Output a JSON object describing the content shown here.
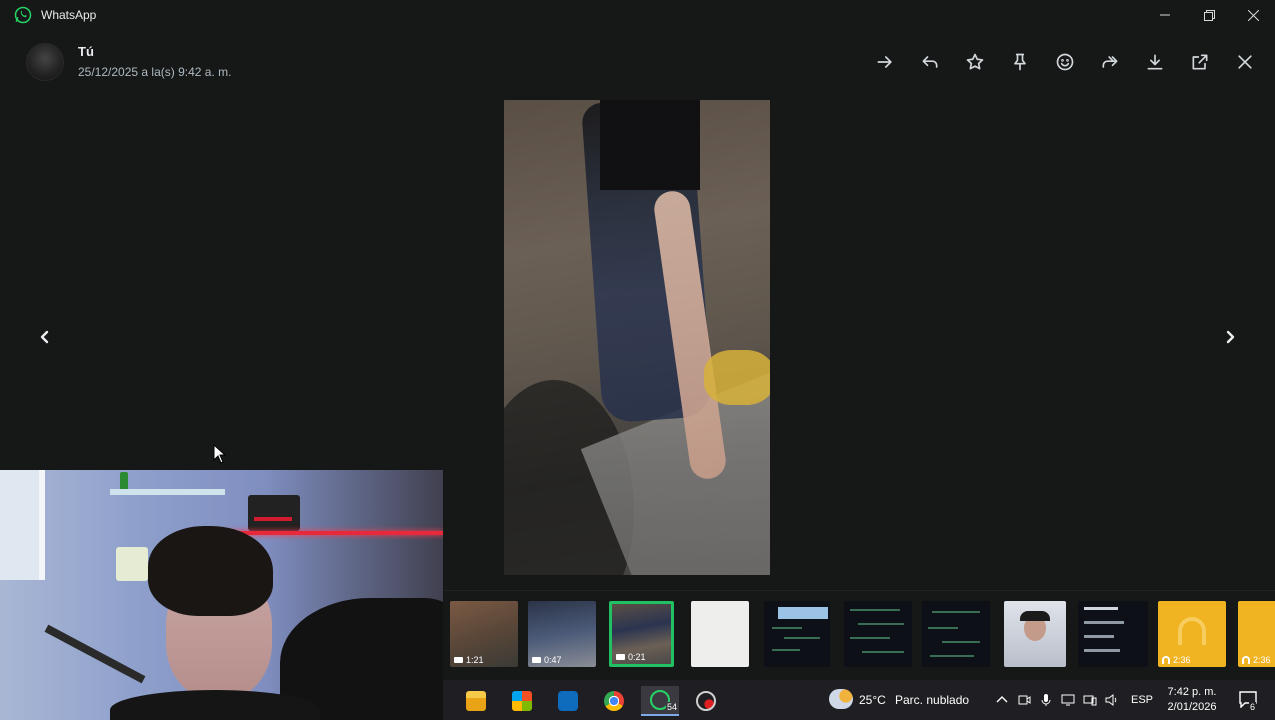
{
  "window": {
    "app_title": "WhatsApp",
    "icons": [
      "whatsapp-logo-icon",
      "minimize-icon",
      "restore-icon",
      "close-icon"
    ]
  },
  "viewer": {
    "sender_name": "Tú",
    "timestamp": "25/12/2025 a la(s) 9:42 a. m.",
    "actions": [
      "go-to-message-icon",
      "reply-icon",
      "star-icon",
      "pin-icon",
      "react-emoji-icon",
      "forward-icon",
      "download-icon",
      "open-external-icon",
      "close-viewer-icon"
    ]
  },
  "thumbnails": [
    {
      "kind": "video",
      "duration": "1:21",
      "selected": false
    },
    {
      "kind": "video",
      "duration": "0:47",
      "selected": false
    },
    {
      "kind": "video",
      "duration": "0:21",
      "selected": true
    },
    {
      "kind": "image",
      "duration": "",
      "selected": false
    },
    {
      "kind": "image",
      "duration": "",
      "selected": false
    },
    {
      "kind": "image",
      "duration": "",
      "selected": false
    },
    {
      "kind": "image",
      "duration": "",
      "selected": false
    },
    {
      "kind": "image",
      "duration": "",
      "selected": false
    },
    {
      "kind": "image",
      "duration": "",
      "selected": false
    },
    {
      "kind": "audio",
      "duration": "2:36",
      "selected": false
    },
    {
      "kind": "audio",
      "duration": "2:36",
      "selected": false
    }
  ],
  "taskbar": {
    "apps": [
      "file-explorer-icon",
      "microsoft-store-icon",
      "outlook-icon",
      "chrome-icon",
      "whatsapp-icon",
      "recorder-icon"
    ],
    "whatsapp_badge": "54",
    "weather_temp": "25°C",
    "weather_desc": "Parc. nublado",
    "language": "ESP",
    "time": "7:42 p. m.",
    "date": "2/01/2026",
    "notification_count": "6"
  },
  "colors": {
    "background": "#161717",
    "selected_border": "#21c063",
    "taskbar": "#1e1e23"
  }
}
